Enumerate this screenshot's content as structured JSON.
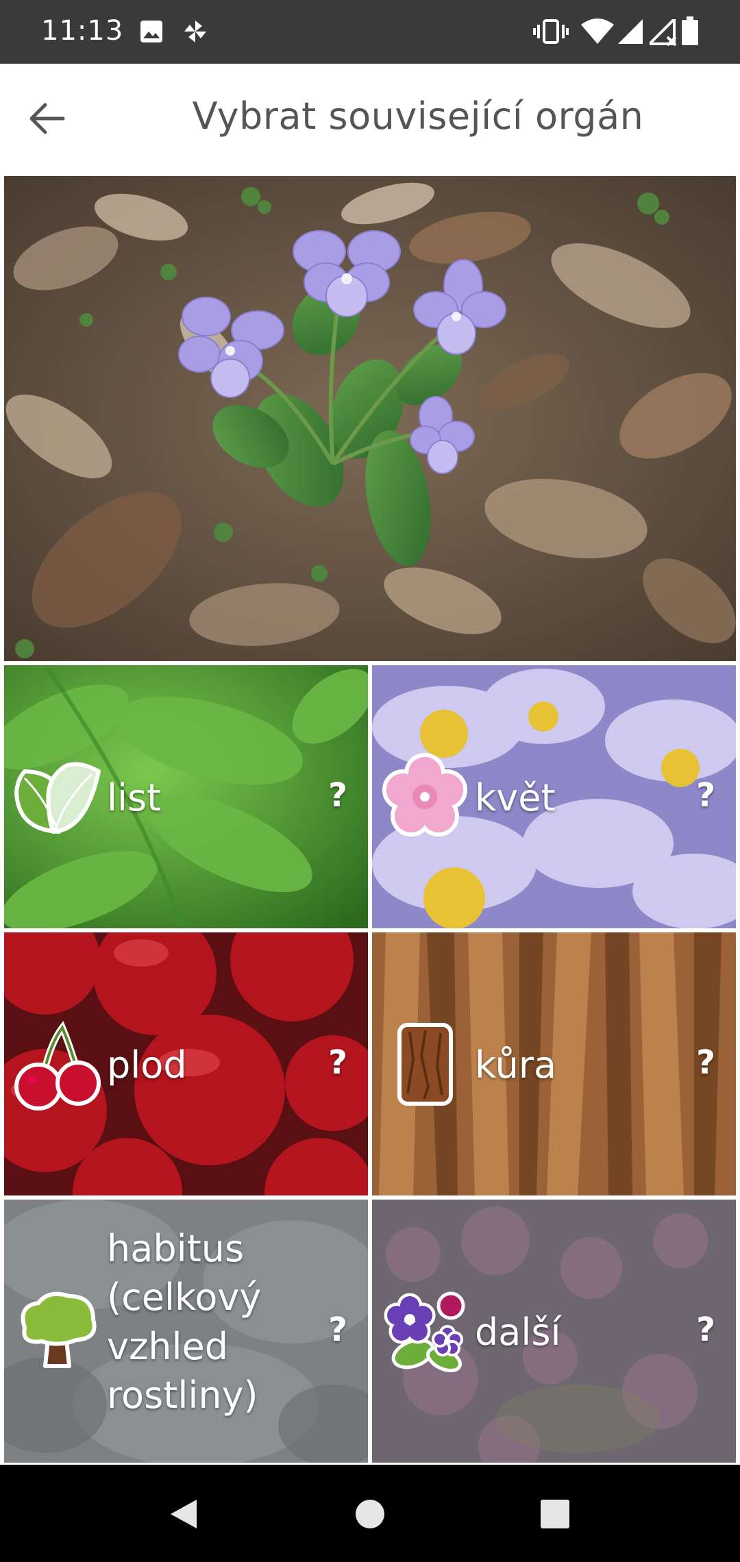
{
  "status_bar": {
    "time": "11:13",
    "left_icons": [
      "image-icon",
      "pinwheel-icon"
    ],
    "right_icons": [
      "vibrate-icon",
      "wifi-icon",
      "signal-icon",
      "signal-no-data-icon",
      "battery-icon"
    ]
  },
  "app_bar": {
    "back_icon": "arrow-back-icon",
    "title": "Vybrat související orgán"
  },
  "photo": {
    "subject": "violet-flower-photo"
  },
  "organs": [
    {
      "id": "leaf",
      "label": "list",
      "help": "?",
      "icon": "leaf-icon"
    },
    {
      "id": "flower",
      "label": "květ",
      "help": "?",
      "icon": "flower-icon"
    },
    {
      "id": "fruit",
      "label": "plod",
      "help": "?",
      "icon": "cherry-icon"
    },
    {
      "id": "bark",
      "label": "kůra",
      "help": "?",
      "icon": "bark-icon"
    },
    {
      "id": "habit",
      "label_lines": [
        "habitus",
        "(celkový",
        "vzhled",
        "rostliny)"
      ],
      "help": "?",
      "icon": "tree-icon"
    },
    {
      "id": "other",
      "label": "další",
      "help": "?",
      "icon": "flowers-icon"
    }
  ],
  "nav_bar": {
    "buttons": [
      "back-triangle-icon",
      "home-circle-icon",
      "recents-square-icon"
    ]
  },
  "colors": {
    "status_bar": "#3a3a3a",
    "title_text": "#555555",
    "nav_bar": "#000000"
  }
}
